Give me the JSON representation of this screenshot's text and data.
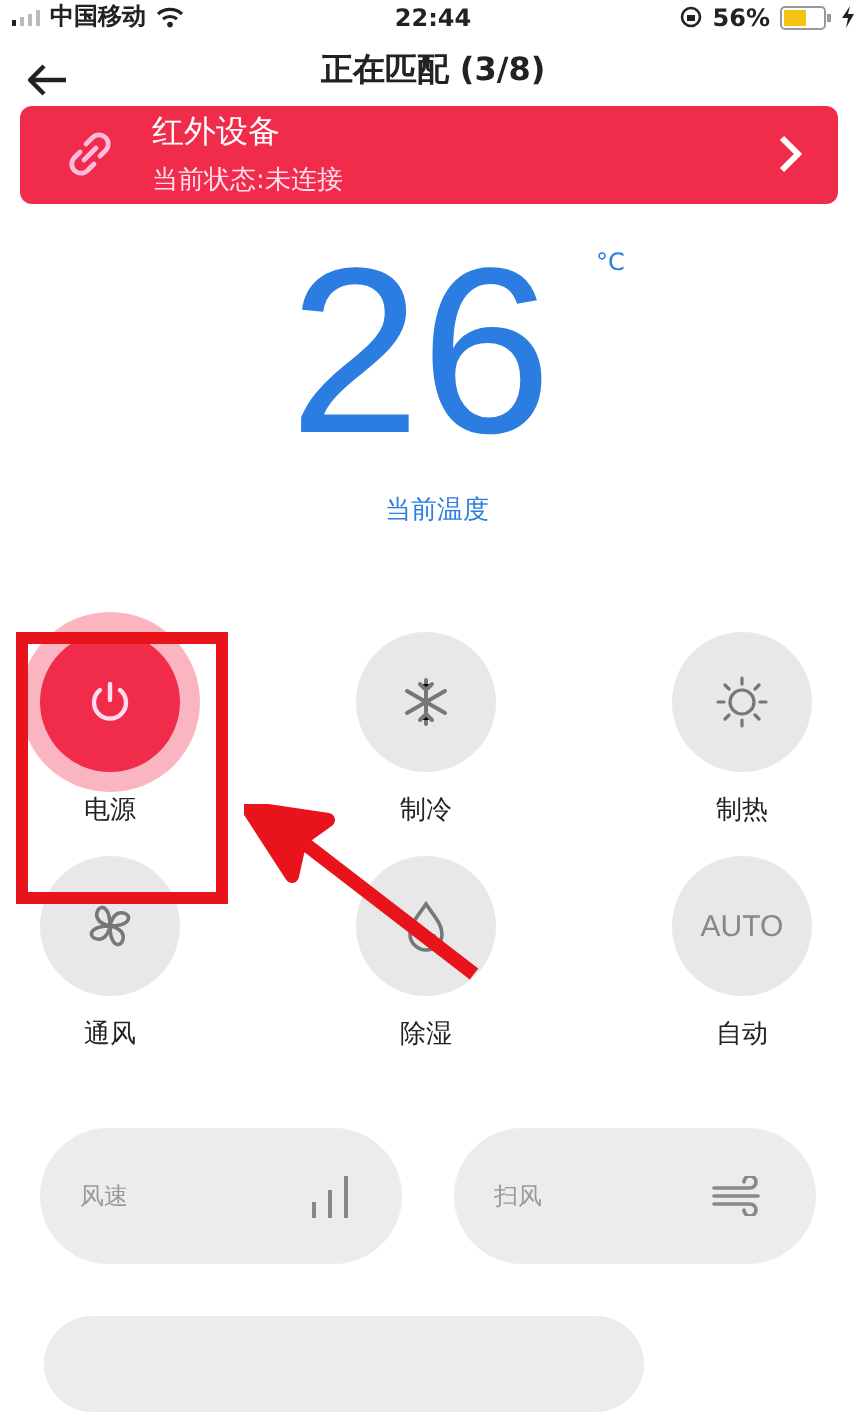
{
  "status_bar": {
    "carrier": "中国移动",
    "time": "22:44",
    "battery": "56%"
  },
  "nav": {
    "title": "正在匹配 (3/8)"
  },
  "device_card": {
    "title": "红外设备",
    "status": "当前状态:未连接"
  },
  "temperature": {
    "value": "26",
    "unit": "°C",
    "label": "当前温度"
  },
  "modes": [
    {
      "kind": "power",
      "label": "电源",
      "on": true
    },
    {
      "kind": "cool",
      "label": "制冷",
      "on": false
    },
    {
      "kind": "heat",
      "label": "制热",
      "on": false
    },
    {
      "kind": "fan",
      "label": "通风",
      "on": false
    },
    {
      "kind": "dry",
      "label": "除湿",
      "on": false
    },
    {
      "kind": "auto",
      "label": "自动",
      "on": false,
      "icon_text": "AUTO"
    }
  ],
  "pills": [
    {
      "kind": "speed",
      "label": "风速"
    },
    {
      "kind": "swing",
      "label": "扫风"
    }
  ]
}
